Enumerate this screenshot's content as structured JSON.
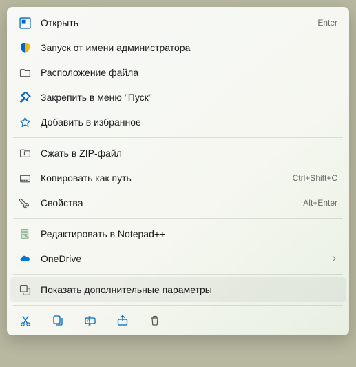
{
  "items": [
    {
      "label": "Открыть",
      "hint": "Enter",
      "icon": "launch"
    },
    {
      "label": "Запуск от имени администратора",
      "icon": "shield"
    },
    {
      "label": "Расположение файла",
      "icon": "folder"
    },
    {
      "label": "Закрепить в меню \"Пуск\"",
      "icon": "pin"
    },
    {
      "label": "Добавить в избранное",
      "icon": "star"
    },
    {
      "label": "Сжать в ZIP-файл",
      "icon": "zip"
    },
    {
      "label": "Копировать как путь",
      "hint": "Ctrl+Shift+C",
      "icon": "copypath"
    },
    {
      "label": "Свойства",
      "hint": "Alt+Enter",
      "icon": "wrench"
    }
  ],
  "extra": [
    {
      "label": "Редактировать в Notepad++",
      "icon": "npp"
    },
    {
      "label": "OneDrive",
      "icon": "onedrive",
      "submenu": true
    }
  ],
  "more": {
    "label": "Показать дополнительные параметры",
    "icon": "expand"
  },
  "actions": [
    "cut",
    "copy",
    "rename",
    "share",
    "delete"
  ]
}
